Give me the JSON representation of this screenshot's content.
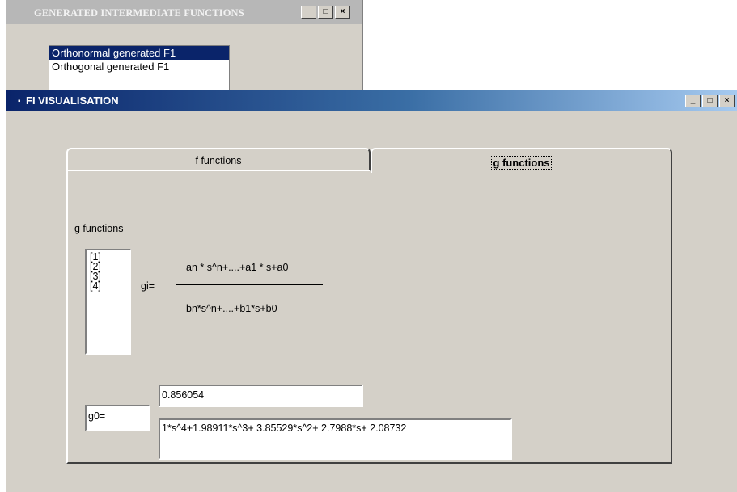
{
  "bg_window": {
    "title": "GENERATED INTERMEDIATE FUNCTIONS",
    "controls": {
      "minimize": "_",
      "maximize": "□",
      "close": "×"
    },
    "list_items": [
      "Orthonormal generated F1",
      "Orthogonal generated F1"
    ],
    "selected_index": 0
  },
  "main_window": {
    "title": "FI VISUALISATION",
    "controls": {
      "minimize": "_",
      "maximize": "□",
      "close": "×"
    },
    "tabs": [
      {
        "label": "f functions",
        "active": false
      },
      {
        "label": "g functions",
        "active": true
      }
    ],
    "g_panel": {
      "heading": "g functions",
      "index_items": [
        "[1]",
        "[2]",
        "[3]",
        "[4]"
      ],
      "gi_label": "gi=",
      "numerator": "an * s^n+....+a1 * s+a0",
      "denominator": "bn*s^n+....+b1*s+b0",
      "g0_label": "g0=",
      "gain_value": "0.856054",
      "polynomial_value": "1*s^4+1.98911*s^3+ 3.85529*s^2+ 2.7988*s+ 2.08732"
    }
  },
  "colors": {
    "window_face": "#d4d0c8",
    "title_active_start": "#0a246a",
    "title_active_end": "#a6caf0",
    "title_inactive": "#b7b7b7",
    "selection": "#0a246a"
  }
}
